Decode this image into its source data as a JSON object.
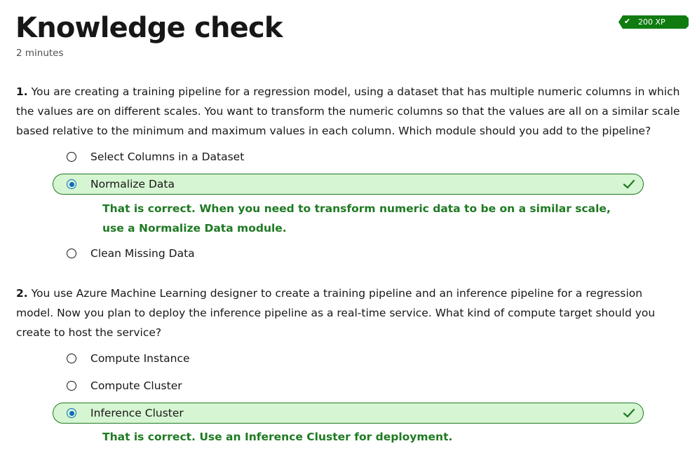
{
  "header": {
    "title": "Knowledge check",
    "duration": "2 minutes",
    "xp_badge": "200 XP"
  },
  "colors": {
    "success": "#1e7a22",
    "success_bg": "#d6f5d2",
    "radio_selected": "#0f6cbd",
    "badge": "#107c10"
  },
  "questions": [
    {
      "number": "1.",
      "text": "You are creating a training pipeline for a regression model, using a dataset that has multiple numeric columns in which the values are on different scales. You want to transform the numeric columns so that the values are all on a similar scale based relative to the minimum and maximum values in each column. Which module should you add to the pipeline?",
      "options": [
        {
          "label": "Select Columns in a Dataset",
          "selected": false
        },
        {
          "label": "Normalize Data",
          "selected": true,
          "correct": true
        },
        {
          "label": "Clean Missing Data",
          "selected": false
        }
      ],
      "feedback": "That is correct. When you need to transform numeric data to be on a similar scale, use a Normalize Data module."
    },
    {
      "number": "2.",
      "text": "You use Azure Machine Learning designer to create a training pipeline and an inference pipeline for a regression model. Now you plan to deploy the inference pipeline as a real-time service. What kind of compute target should you create to host the service?",
      "options": [
        {
          "label": "Compute Instance",
          "selected": false
        },
        {
          "label": "Compute Cluster",
          "selected": false
        },
        {
          "label": "Inference Cluster",
          "selected": true,
          "correct": true
        }
      ],
      "feedback": "That is correct. Use an Inference Cluster for deployment."
    }
  ]
}
